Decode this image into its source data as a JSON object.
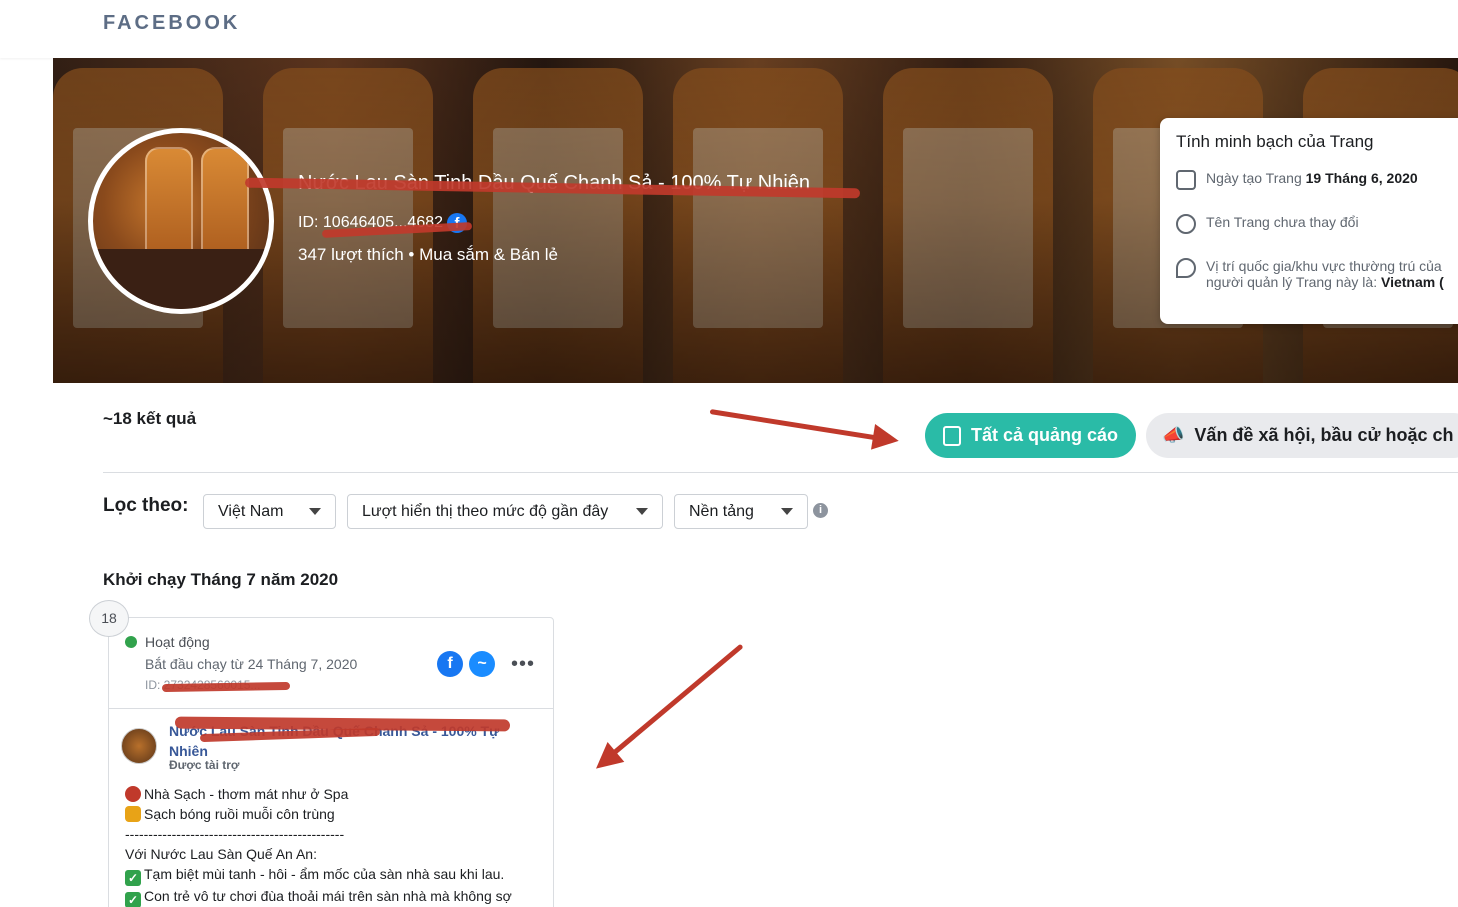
{
  "header": {
    "brand": "FACEBOOK"
  },
  "page": {
    "name": "Nước Lau Sàn Tinh Dầu Quế Chanh Sả - 100% Tự Nhiên",
    "id_label": "ID: 10646405...4682",
    "likes_category": "347 lượt thích • Mua sắm & Bán lẻ"
  },
  "transparency": {
    "title": "Tính minh bạch của Trang",
    "created_label": "Ngày tạo Trang",
    "created_date": "19 Tháng 6, 2020",
    "name_change": "Tên Trang chưa thay đổi",
    "location_text": "Vị trí quốc gia/khu vực thường trú của người quản lý Trang này là:",
    "location_value": "Vietnam ("
  },
  "results": {
    "count": "~18 kết quả",
    "all_ads": "Tất cả quảng cáo",
    "social_issues": "Vấn đề xã hội, bầu cử hoặc ch"
  },
  "filters": {
    "label": "Lọc theo:",
    "country": "Việt Nam",
    "sort": "Lượt hiển thị theo mức độ gần đây",
    "platform": "Nền tảng"
  },
  "section_title": "Khởi chạy Tháng 7 năm 2020",
  "ad_count": "18",
  "ad": {
    "status": "Hoạt động",
    "started": "Bắt đầu chạy từ 24 Tháng 7, 2020",
    "id": "ID: 2732428560015...",
    "page_name": "Nước Lau Sàn Tinh Dầu Quế Chanh Sả - 100% Tự Nhiên",
    "sponsored": "Được tài trợ",
    "lines": [
      "Nhà Sạch - thơm mát như ở Spa",
      "Sạch bóng ruồi muỗi côn trùng",
      "-----------------------------------------------",
      "Với Nước Lau Sàn Quế An An:",
      "Tạm biệt mùi tanh - hôi - ẩm mốc của sàn nhà sau khi lau.",
      "Con trẻ vô tư chơi đùa thoải mái trên sàn nhà mà không sợ"
    ]
  },
  "colors": {
    "accent": "#2abba7",
    "annotation": "#c0392b",
    "brand": "#5d6d85"
  }
}
